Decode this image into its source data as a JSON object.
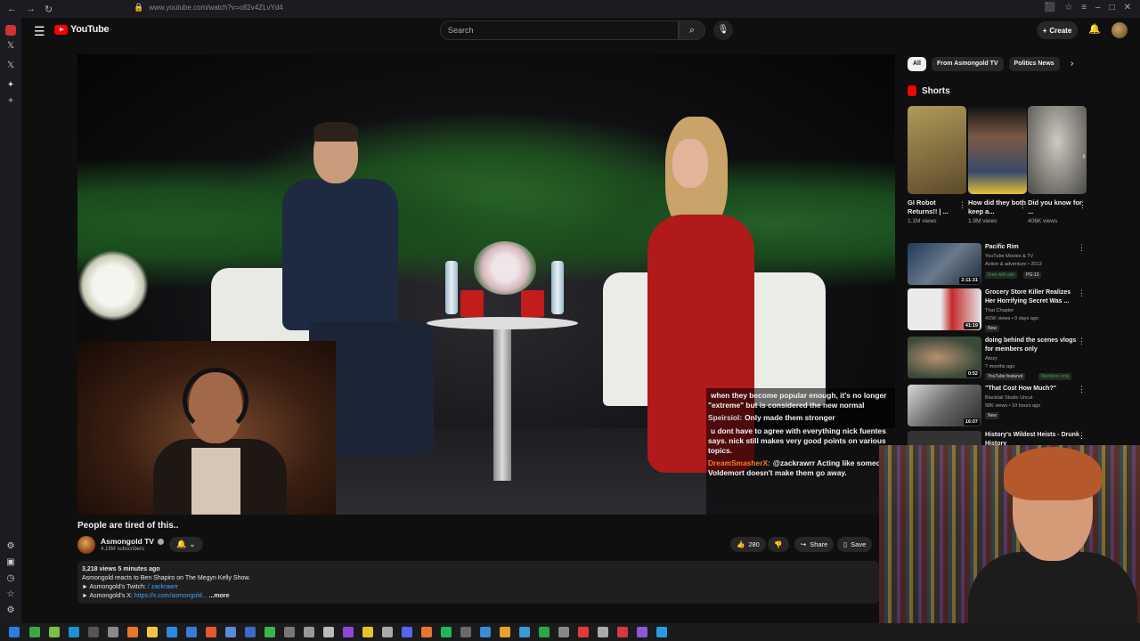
{
  "browser": {
    "url": "www.youtube.com/watch?v=o82v4ZLvYd4"
  },
  "header": {
    "logo_text": "YouTube",
    "search_placeholder": "Search",
    "create_label": "Create"
  },
  "video": {
    "title": "People are tired of this..",
    "channel": "Asmongold TV",
    "subscribers": "4.16M subscribers",
    "likes": "280",
    "share_label": "Share",
    "save_label": "Save"
  },
  "chat": [
    {
      "user": "",
      "text": "when they become popular enough, it's no longer \"extreme\" but is considered the new normal",
      "user_color": "#e0402a"
    },
    {
      "user": "Speirsiol:",
      "text": "Only made them stronger",
      "user_color": "#d6d6d6"
    },
    {
      "user": "",
      "text": "u dont have to agree with everything nick fuentes says. nick still makes very good points on various topics.",
      "user_color": "#7a3fb0"
    },
    {
      "user": "DreamSmasherX:",
      "text": "@zackrawrr Acting like someone Voldemort doesn't make them go away.",
      "user_color": "#ff7a2a"
    }
  ],
  "description": {
    "meta": "3,218 views  5 minutes ago",
    "line1": "Asmongold reacts to Ben Shapiro on The Megyn Kelly Show.",
    "line2_prefix": "► Asmongold's Twitch: ",
    "line2_link": "/ zackrawrr",
    "line3_prefix": "► Asmongold's X: ",
    "line3_link": "https://x.com/asmongold...",
    "more": "...more"
  },
  "chips": [
    "All",
    "From Asmongold TV",
    "Politics News"
  ],
  "shorts": {
    "heading": "Shorts",
    "items": [
      {
        "title": "GI Robot Returns!! | ...",
        "views": "1.1M views",
        "color": "#8a7a4a"
      },
      {
        "title": "How did they both keep a...",
        "views": "1.9M views",
        "color": "#5a4a3a"
      },
      {
        "title": "Did you know for ...",
        "views": "406K views",
        "color": "#6e6a66"
      }
    ]
  },
  "recommendations": [
    {
      "title": "Pacific Rim",
      "channel": "YouTube Movies & TV",
      "meta": "Action & adventure • 2013",
      "badges": [
        "Free with ads",
        "PG-13"
      ],
      "duration": "2:11:31",
      "color": "#2c3e5a"
    },
    {
      "title": "Grocery Store Killer Realizes Her Horrifying Secret Was ...",
      "channel": "That Chapter",
      "meta": "415K views • 9 days ago",
      "badges": [
        "New"
      ],
      "duration": "41:19",
      "color": "#c23a2a"
    },
    {
      "title": "doing behind the scenes vlogs for members only",
      "channel": "Atozy",
      "meta": "7 months ago",
      "badges": [
        "YouTube featured",
        "Members only"
      ],
      "duration": "0:52",
      "color": "#3a4a3a"
    },
    {
      "title": "\"That Cost How Much?\"",
      "channel": "Blacktail Studio Uncut",
      "meta": "58K views • 10 hours ago",
      "badges": [
        "New"
      ],
      "duration": "16:07",
      "color": "#4a4a4a"
    },
    {
      "title": "History's Wildest Heists - Drunk History",
      "channel": "",
      "meta": "",
      "badges": [],
      "duration": "",
      "color": "#333"
    }
  ]
}
